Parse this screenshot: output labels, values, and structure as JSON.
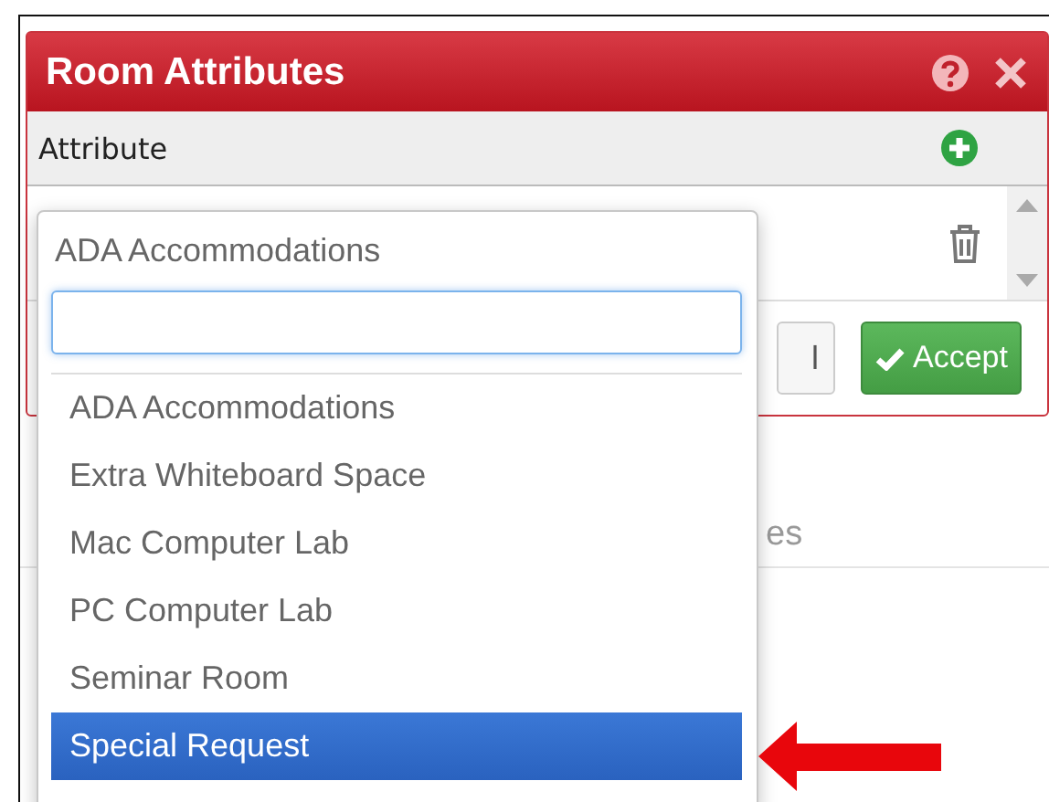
{
  "dialog": {
    "title": "Room Attributes",
    "column_header": "Attribute",
    "footer": {
      "partial_button": "l",
      "accept_button": "Accept"
    }
  },
  "background": {
    "text_fragment": "es"
  },
  "dropdown": {
    "current_value": "ADA Accommodations",
    "search_field": {
      "focused": true
    },
    "options": [
      {
        "label": "ADA Accommodations",
        "selected": false
      },
      {
        "label": "Extra Whiteboard Space",
        "selected": false
      },
      {
        "label": "Mac Computer Lab",
        "selected": false
      },
      {
        "label": "PC Computer Lab",
        "selected": false
      },
      {
        "label": "Seminar Room",
        "selected": false
      },
      {
        "label": "Special Request",
        "selected": true
      }
    ]
  }
}
